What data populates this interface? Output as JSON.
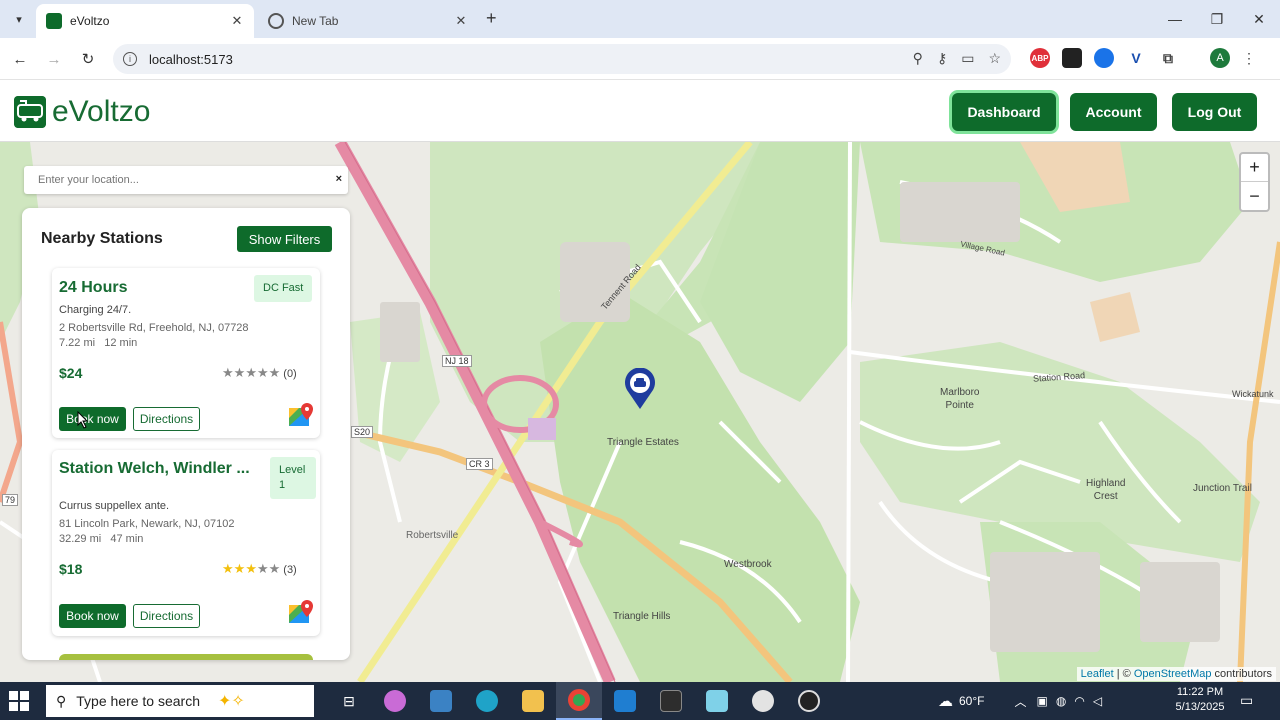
{
  "browser": {
    "tabs": [
      {
        "title": "eVoltzo",
        "active": true
      },
      {
        "title": "New Tab",
        "active": false
      }
    ],
    "url": "localhost:5173",
    "profile_initial": "A",
    "extensions": [
      "ABP"
    ]
  },
  "app": {
    "brand": "eVoltzo",
    "nav": {
      "dashboard": "Dashboard",
      "account": "Account",
      "logout": "Log Out"
    },
    "brand_color": "#0e6b2b"
  },
  "search": {
    "placeholder": "Enter your location...",
    "clear": "×"
  },
  "stations_panel": {
    "title": "Nearby Stations",
    "filters_button": "Show Filters",
    "stations": [
      {
        "name": "24 Hours",
        "badge": "DC Fast",
        "description": "Charging 24/7.",
        "address": "2 Robertsville Rd, Freehold, NJ, 07728",
        "distance": "7.22 mi",
        "duration": "12 min",
        "price": "$24",
        "rating": 0,
        "reviews": "(0)",
        "book": "Book now",
        "directions": "Directions"
      },
      {
        "name": "Station Welch, Windler ...",
        "badge": "Level 1",
        "description": "Currus suppellex ante.",
        "address": "81 Lincoln Park, Newark, NJ, 07102",
        "distance": "32.29 mi",
        "duration": "47 min",
        "price": "$18",
        "rating": 3,
        "reviews": "(3)",
        "book": "Book now",
        "directions": "Directions"
      }
    ]
  },
  "map": {
    "zoom_in": "+",
    "zoom_out": "−",
    "attribution": {
      "leaflet": "Leaflet",
      "sep": " | © ",
      "osm": "OpenStreetMap",
      "suffix": " contributors"
    },
    "labels": {
      "triangle_estates": "Triangle Estates",
      "robertsville": "Robertsville",
      "westbrook": "Westbrook",
      "triangle_hills": "Triangle Hills",
      "marlboro_pointe_1": "Marlboro",
      "marlboro_pointe_2": "Pointe",
      "highland_crest_1": "Highland",
      "highland_crest_2": "Crest",
      "junction_trail": "Junction Trail",
      "station_road": "Station Road",
      "tennent_road": "Tennent Road",
      "nj18": "NJ 18",
      "cr3": "CR 3",
      "s20": "S20",
      "village_road": "Village Road",
      "wickatunk": "Wickatunk",
      "route_79": "79"
    }
  },
  "taskbar": {
    "search_placeholder": "Type here to search",
    "weather": "60°F",
    "time": "11:22 PM",
    "date": "5/13/2025"
  }
}
